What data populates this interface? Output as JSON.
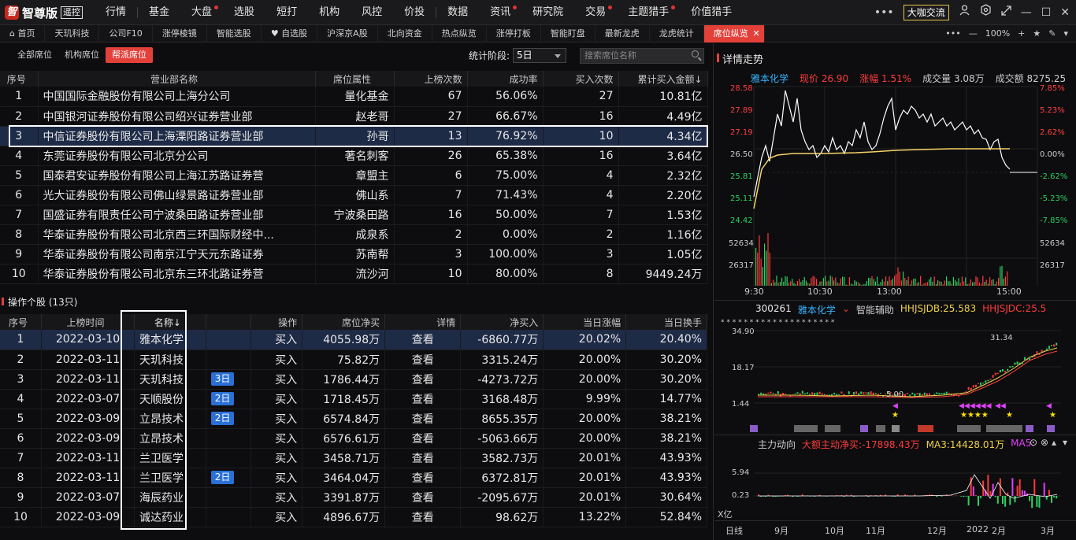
{
  "app": {
    "logo_mark": "智",
    "name": "智尊版",
    "edition": "遥控"
  },
  "menu": [
    "行情",
    "基金",
    "大盘",
    "选股",
    "短打",
    "机构",
    "风控",
    "价投",
    "数据",
    "资讯",
    "研究院",
    "交易",
    "主题猎手",
    "价值猎手"
  ],
  "menu_dots": [
    2,
    9,
    11,
    12
  ],
  "top_right": {
    "exchange": "大咖交流"
  },
  "tabs": [
    {
      "label": "首页",
      "icon": "home-icon"
    },
    {
      "label": "天玑科技"
    },
    {
      "label": "公司F10"
    },
    {
      "label": "涨停棱镜"
    },
    {
      "label": "智能选股"
    },
    {
      "label": "自选股",
      "icon": "heart-icon"
    },
    {
      "label": "沪深京A股"
    },
    {
      "label": "北向资金"
    },
    {
      "label": "热点纵览"
    },
    {
      "label": "涨停打板"
    },
    {
      "label": "智能盯盘"
    },
    {
      "label": "最新龙虎"
    },
    {
      "label": "龙虎统计"
    },
    {
      "label": "席位纵览",
      "active": true
    }
  ],
  "tab_tools": {
    "zoom": "100%"
  },
  "left": {
    "subtabs": [
      "全部席位",
      "机构席位",
      "帮派席位"
    ],
    "active_subtab": 2,
    "period_label": "统计阶段:",
    "period_value": "5日",
    "search_placeholder": "搜索席位名称",
    "seat_table": {
      "headers": [
        "序号",
        "营业部名称",
        "席位属性",
        "上榜次数",
        "成功率",
        "买入次数",
        "累计买入金额↓"
      ],
      "rows": [
        [
          "1",
          "中国国际金融股份有限公司上海分公司",
          "量化基金",
          "67",
          "56.06%",
          "27",
          "10.81亿"
        ],
        [
          "2",
          "中国银河证券股份有限公司绍兴证券营业部",
          "赵老哥",
          "27",
          "66.67%",
          "16",
          "4.49亿"
        ],
        [
          "3",
          "中信证券股份有限公司上海溧阳路证券营业部",
          "孙哥",
          "13",
          "76.92%",
          "10",
          "4.34亿"
        ],
        [
          "4",
          "东莞证券股份有限公司北京分公司",
          "著名刺客",
          "26",
          "65.38%",
          "16",
          "3.64亿"
        ],
        [
          "5",
          "国泰君安证券股份有限公司上海江苏路证券营",
          "章盟主",
          "6",
          "75.00%",
          "4",
          "2.32亿"
        ],
        [
          "6",
          "光大证券股份有限公司佛山绿景路证券营业部",
          "佛山系",
          "7",
          "71.43%",
          "4",
          "2.20亿"
        ],
        [
          "7",
          "国盛证券有限责任公司宁波桑田路证券营业部",
          "宁波桑田路",
          "16",
          "50.00%",
          "7",
          "1.53亿"
        ],
        [
          "8",
          "华泰证券股份有限公司北京西三环国际财经中...",
          "成泉系",
          "2",
          "0.00%",
          "2",
          "1.16亿"
        ],
        [
          "9",
          "华泰证券股份有限公司南京江宁天元东路证券",
          "苏南帮",
          "3",
          "100.00%",
          "3",
          "1.05亿"
        ],
        [
          "10",
          "华泰证券股份有限公司北京东三环北路证券营",
          "流沙河",
          "10",
          "80.00%",
          "8",
          "9449.24万"
        ]
      ]
    },
    "stocks_title": "操作个股 (13只)",
    "stock_table": {
      "headers": [
        "序号",
        "上榜时间",
        "名称↓",
        "",
        "操作",
        "席位净买",
        "详情",
        "净买入",
        "当日涨幅",
        "当日换手"
      ],
      "rows": [
        [
          "1",
          "2022-03-10",
          "雅本化学",
          "",
          "买入",
          "4055.98万",
          "查看",
          "-6860.77万",
          "20.02%",
          "20.40%"
        ],
        [
          "2",
          "2022-03-11",
          "天玑科技",
          "",
          "买入",
          "75.82万",
          "查看",
          "3315.24万",
          "20.00%",
          "30.20%"
        ],
        [
          "3",
          "2022-03-11",
          "天玑科技",
          "3日",
          "买入",
          "1786.44万",
          "查看",
          "-4273.72万",
          "20.00%",
          "30.20%"
        ],
        [
          "4",
          "2022-03-07",
          "天顺股份",
          "2日",
          "买入",
          "1718.45万",
          "查看",
          "3168.48万",
          "9.99%",
          "14.77%"
        ],
        [
          "5",
          "2022-03-09",
          "立昂技术",
          "2日",
          "买入",
          "6574.84万",
          "查看",
          "8655.35万",
          "20.00%",
          "38.21%"
        ],
        [
          "6",
          "2022-03-09",
          "立昂技术",
          "",
          "买入",
          "6576.61万",
          "查看",
          "-5063.66万",
          "20.00%",
          "38.21%"
        ],
        [
          "7",
          "2022-03-11",
          "兰卫医学",
          "",
          "买入",
          "3458.71万",
          "查看",
          "3582.73万",
          "20.01%",
          "43.93%"
        ],
        [
          "8",
          "2022-03-11",
          "兰卫医学",
          "2日",
          "买入",
          "3464.04万",
          "查看",
          "6372.81万",
          "20.01%",
          "43.93%"
        ],
        [
          "9",
          "2022-03-07",
          "海辰药业",
          "",
          "买入",
          "3391.87万",
          "查看",
          "-2095.67万",
          "20.01%",
          "30.64%"
        ],
        [
          "10",
          "2022-03-09",
          "诚达药业",
          "",
          "买入",
          "4896.67万",
          "查看",
          "98.62万",
          "13.22%",
          "52.84%"
        ]
      ]
    }
  },
  "right": {
    "title": "详情走势",
    "quote": {
      "name": "雅本化学",
      "price": "现价 26.90",
      "change": "涨幅 1.51%",
      "volume": "成交量 3.08万",
      "amount": "成交额 8275.25"
    },
    "intraday": {
      "y_left": [
        "28.58",
        "27.89",
        "27.19",
        "26.50",
        "25.81",
        "25.11",
        "24.42"
      ],
      "y_right": [
        "7.85%",
        "5.23%",
        "2.62%",
        "0.00%",
        "-2.62%",
        "-5.23%",
        "-7.85%"
      ],
      "vol_left": [
        "52634",
        "26317"
      ],
      "vol_right": [
        "52634",
        "26317"
      ],
      "x": [
        "9:30",
        "10:30",
        "13:00",
        "15:00"
      ]
    },
    "kline": {
      "code": "300261",
      "name": "雅本化学",
      "aux": "智能辅助",
      "ind1": "HHJSJDB:25.583",
      "ind2": "HHJSJDC:25.5",
      "y": [
        "34.90",
        "18.17",
        "1.44"
      ],
      "high_label": "31.34",
      "low_label": "5.00"
    },
    "mainflow": {
      "label": "主力动向",
      "net": "大额主动净买:-17898.43万",
      "ma3": "MA3:14428.01万",
      "ma5": "MA5:",
      "y": [
        "5.94",
        "0.23"
      ],
      "unit": "X亿"
    },
    "x_axis": {
      "period": "日线",
      "ticks": [
        "9月",
        "10月",
        "11月",
        "12月",
        "2022",
        "2月",
        "3月"
      ]
    }
  }
}
